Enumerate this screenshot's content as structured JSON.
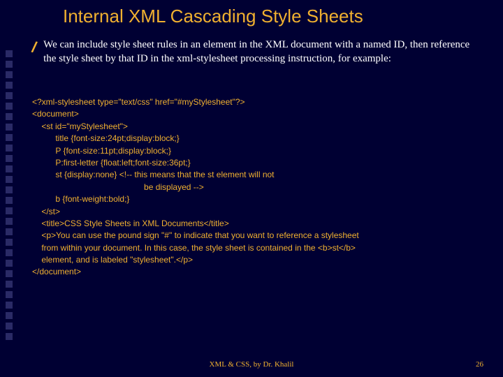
{
  "title": "Internal XML Cascading Style Sheets",
  "intro": "We can include style sheet rules in an element in the XML document with a named ID, then reference the style sheet by that ID in the xml-stylesheet processing instruction, for example:",
  "code": "<?xml-stylesheet type=\"text/css\" href=\"#myStylesheet\"?>\n<document>\n    <st id=\"myStylesheet\">\n          title {font-size:24pt;display:block;}\n          P {font-size:11pt;display:block;}\n          P:first-letter {float:left;font-size:36pt;}\n          st {display:none} <!-- this means that the st element will not\n                                                be displayed -->\n          b {font-weight:bold;}\n    </st>\n    <title>CSS Style Sheets in XML Documents</title>\n    <p>You can use the pound sign \"#\" to indicate that you want to reference a stylesheet\n    from within your document. In this case, the style sheet is contained in the <b>st</b>\n    element, and is labeled \"stylesheet\".</p>\n</document>",
  "footer": "XML & CSS, by Dr. Khalil",
  "page": "26"
}
